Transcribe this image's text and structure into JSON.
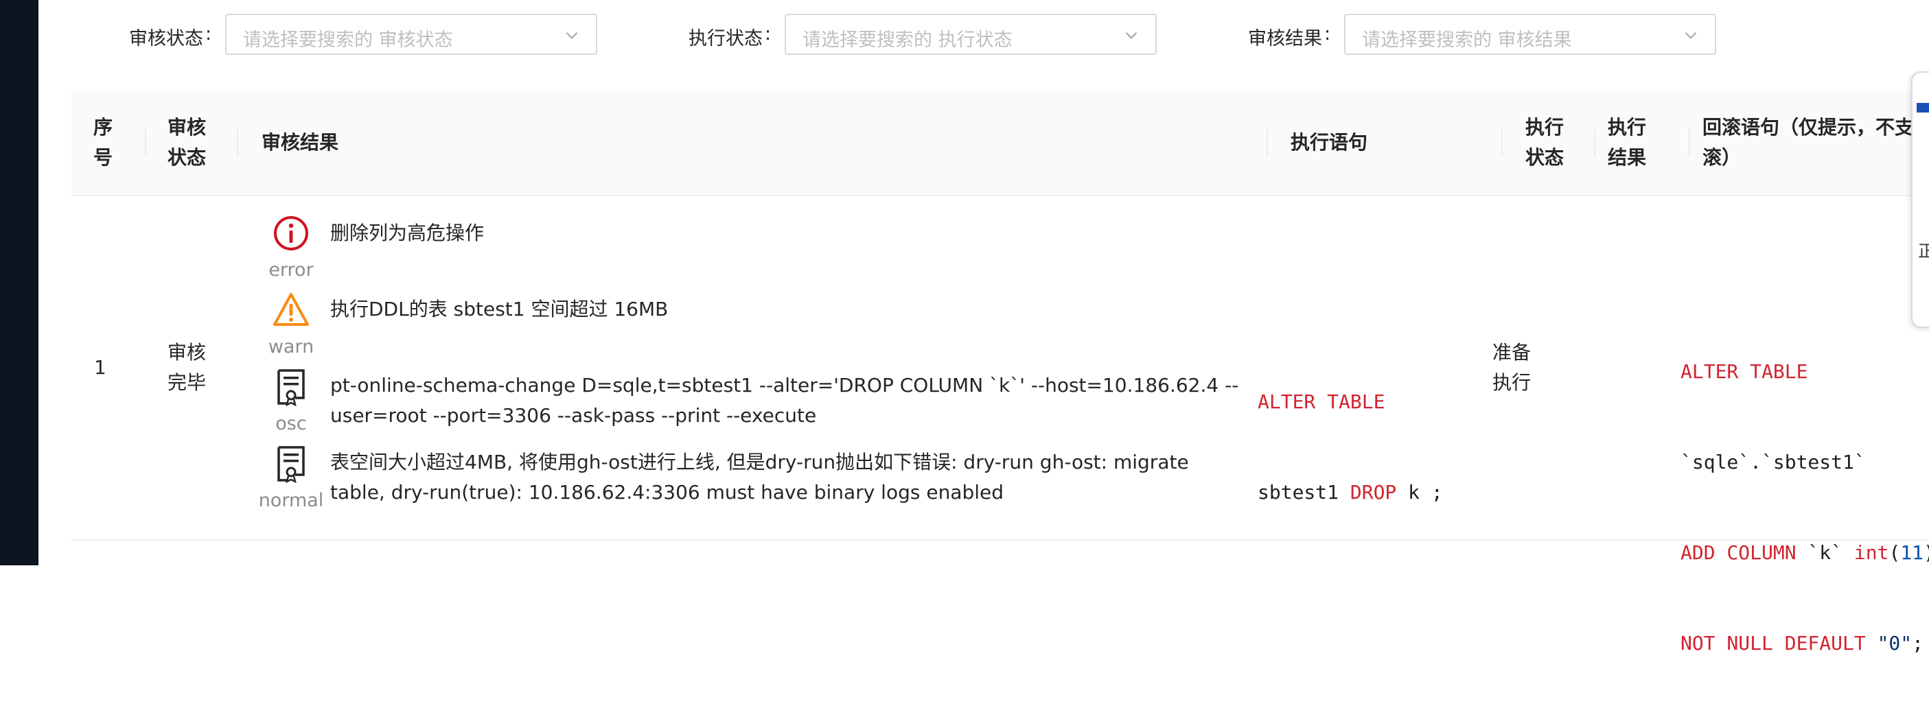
{
  "filters": [
    {
      "label": "审核状态",
      "placeholder": "请选择要搜索的 审核状态"
    },
    {
      "label": "执行状态",
      "placeholder": "请选择要搜索的 执行状态"
    },
    {
      "label": "审核结果",
      "placeholder": "请选择要搜索的 审核结果"
    }
  ],
  "table": {
    "headers": {
      "seq": [
        "序",
        "号"
      ],
      "audit_status": [
        "审核",
        "状态"
      ],
      "audit_result": "审核结果",
      "exec_sql": "执行语句",
      "exec_status": [
        "执行",
        "状态"
      ],
      "exec_result": [
        "执行",
        "结果"
      ],
      "rollback": [
        "回滚语句（仅提示，不支持",
        "滚）"
      ]
    },
    "rows": [
      {
        "seq": "1",
        "audit_status": [
          "审核",
          "完毕"
        ],
        "results": [
          {
            "level": "error",
            "icon": "error-icon",
            "lines": [
              "删除列为高危操作"
            ]
          },
          {
            "level": "warn",
            "icon": "warning-icon",
            "lines": [
              "执行DDL的表 sbtest1 空间超过 16MB"
            ]
          },
          {
            "level": "osc",
            "icon": "document-icon",
            "lines": [
              "pt-online-schema-change D=sqle,t=sbtest1 --alter='DROP COLUMN `k`' --host=10.186.62.4 --",
              "user=root --port=3306 --ask-pass --print --execute"
            ]
          },
          {
            "level": "normal",
            "icon": "document-icon",
            "lines": [
              "表空间大小超过4MB, 将使用gh-ost进行上线, 但是dry-run抛出如下错误: dry-run gh-ost: migrate",
              "table, dry-run(true): 10.186.62.4:3306 must have binary logs enabled"
            ]
          }
        ],
        "exec_sql": {
          "kw1": "ALTER TABLE",
          "t1": "sbtest1 ",
          "kw2": "DROP",
          "t2": " k ;"
        },
        "exec_status": [
          "准备",
          "执行"
        ],
        "exec_result": "",
        "rollback": {
          "l1_kw": "ALTER TABLE",
          "l2_text": "`sqle`.`sbtest1`",
          "l3_kw": "ADD COLUMN",
          "l3_text": " `k` ",
          "l3_kw2": "int",
          "l3_p1": "(",
          "l3_num": "11",
          "l3_p2": ")",
          "l4_kw": "NOT NULL DEFAULT",
          "l4_sp": " ",
          "l4_str": "\"0\"",
          "l4_end": ";"
        }
      }
    ]
  },
  "overlay": {
    "char": "正"
  },
  "colors": {
    "keyword": "#d1242f",
    "number": "#0550ae",
    "error": "#d4380d",
    "warn": "#fa8c16",
    "header_bg": "#fafafa"
  }
}
